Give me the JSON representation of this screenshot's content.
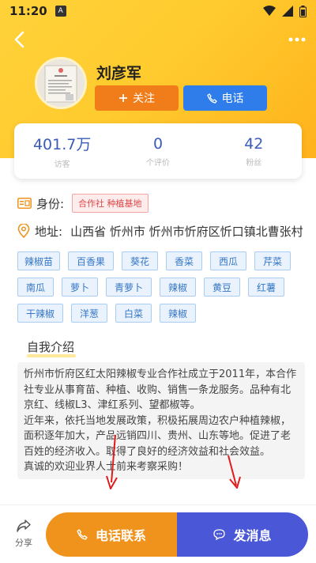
{
  "status": {
    "time": "11:20",
    "badge": "A"
  },
  "profile": {
    "name": "刘彦军",
    "follow_label": "关注",
    "call_label": "电话"
  },
  "stats": [
    {
      "value": "401.7万",
      "label": "访客"
    },
    {
      "value": "0",
      "label": "个评价"
    },
    {
      "value": "42",
      "label": "粉丝"
    }
  ],
  "identity": {
    "label": "身份:",
    "badge": "合作社 种植基地"
  },
  "address": {
    "label": "地址:",
    "value": "山西省 忻州市 忻州市忻府区忻口镇北曹张村"
  },
  "tags": [
    "辣椒苗",
    "百香果",
    "葵花",
    "香菜",
    "西瓜",
    "芹菜",
    "南瓜",
    "萝卜",
    "青萝卜",
    "辣椒",
    "黄豆",
    "红薯",
    "干辣椒",
    "洋葱",
    "白菜",
    "辣椒"
  ],
  "intro": {
    "title": "自我介绍",
    "text": "忻州市忻府区红太阳辣椒专业合作社成立于2011年，本合作社专业从事育苗、种植、收购、销售一条龙服务。品种有北京红、线椒L3、津红系列、望都椒等。\n近年来，依托当地发展政策，积极拓展周边农户种植辣椒，面积逐年加大，产品远销四川、贵州、山东等地。促进了老百姓的经济收入。取得了良好的经济效益和社会效益。\n真诚的欢迎业界人士前来考察采购！"
  },
  "bottom": {
    "share_label": "分享",
    "phone_label": "电话联系",
    "message_label": "发消息"
  },
  "colors": {
    "accent_orange": "#f07d1a",
    "accent_blue": "#2e7dea",
    "message_blue": "#4a57d6",
    "stat_blue": "#3b5bb8"
  }
}
